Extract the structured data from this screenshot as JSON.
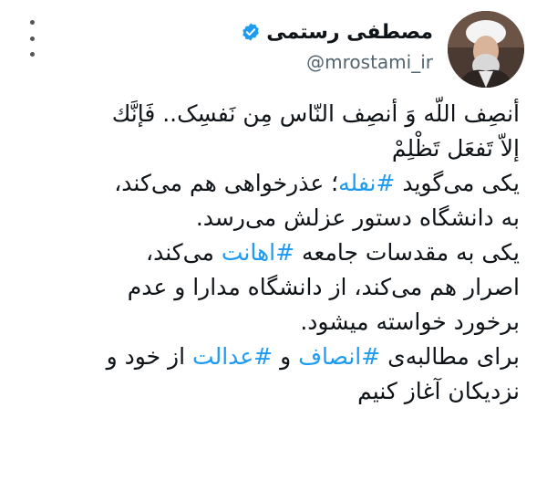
{
  "author": {
    "name": "مصطفی رستمی",
    "handle": "@mrostami_ir",
    "verified_color": "#1d9bf0",
    "avatar_icon": "cleric-portrait"
  },
  "menu_icon": "more-vertical-icon",
  "accent_color": "#1d9bf0",
  "tweet": {
    "lines": [
      {
        "segments": [
          {
            "text": "أنصِف اللّه وَ أنصِف النّاس مِن نَفسِک.. فَإنَّك",
            "hashtag": false
          }
        ]
      },
      {
        "segments": [
          {
            "text": "إلاّ تَفعَل تَظْلِمْ",
            "hashtag": false
          }
        ]
      },
      {
        "segments": [
          {
            "text": "یکی می‌گوید ",
            "hashtag": false
          },
          {
            "text": "#نفله",
            "hashtag": true
          },
          {
            "text": "؛ عذرخواهی هم می‌کند،",
            "hashtag": false
          }
        ]
      },
      {
        "segments": [
          {
            "text": "به دانشگاه دستور عزلش می‌رسد.",
            "hashtag": false
          }
        ]
      },
      {
        "segments": [
          {
            "text": "یکی به مقدسات جامعه ",
            "hashtag": false
          },
          {
            "text": "#اهانت",
            "hashtag": true
          },
          {
            "text": " می‌کند،",
            "hashtag": false
          }
        ]
      },
      {
        "segments": [
          {
            "text": "اصرار هم می‌کند، از دانشگاه مدارا و عدم",
            "hashtag": false
          }
        ]
      },
      {
        "segments": [
          {
            "text": "برخورد خواسته میشود.",
            "hashtag": false
          }
        ]
      },
      {
        "segments": [
          {
            "text": "برای مطالبه‌ی ",
            "hashtag": false
          },
          {
            "text": "#انصاف",
            "hashtag": true
          },
          {
            "text": " و ",
            "hashtag": false
          },
          {
            "text": "#عدالت",
            "hashtag": true
          },
          {
            "text": " از خود و",
            "hashtag": false
          }
        ]
      },
      {
        "segments": [
          {
            "text": "نزدیکان آغاز کنیم",
            "hashtag": false
          }
        ]
      }
    ]
  }
}
